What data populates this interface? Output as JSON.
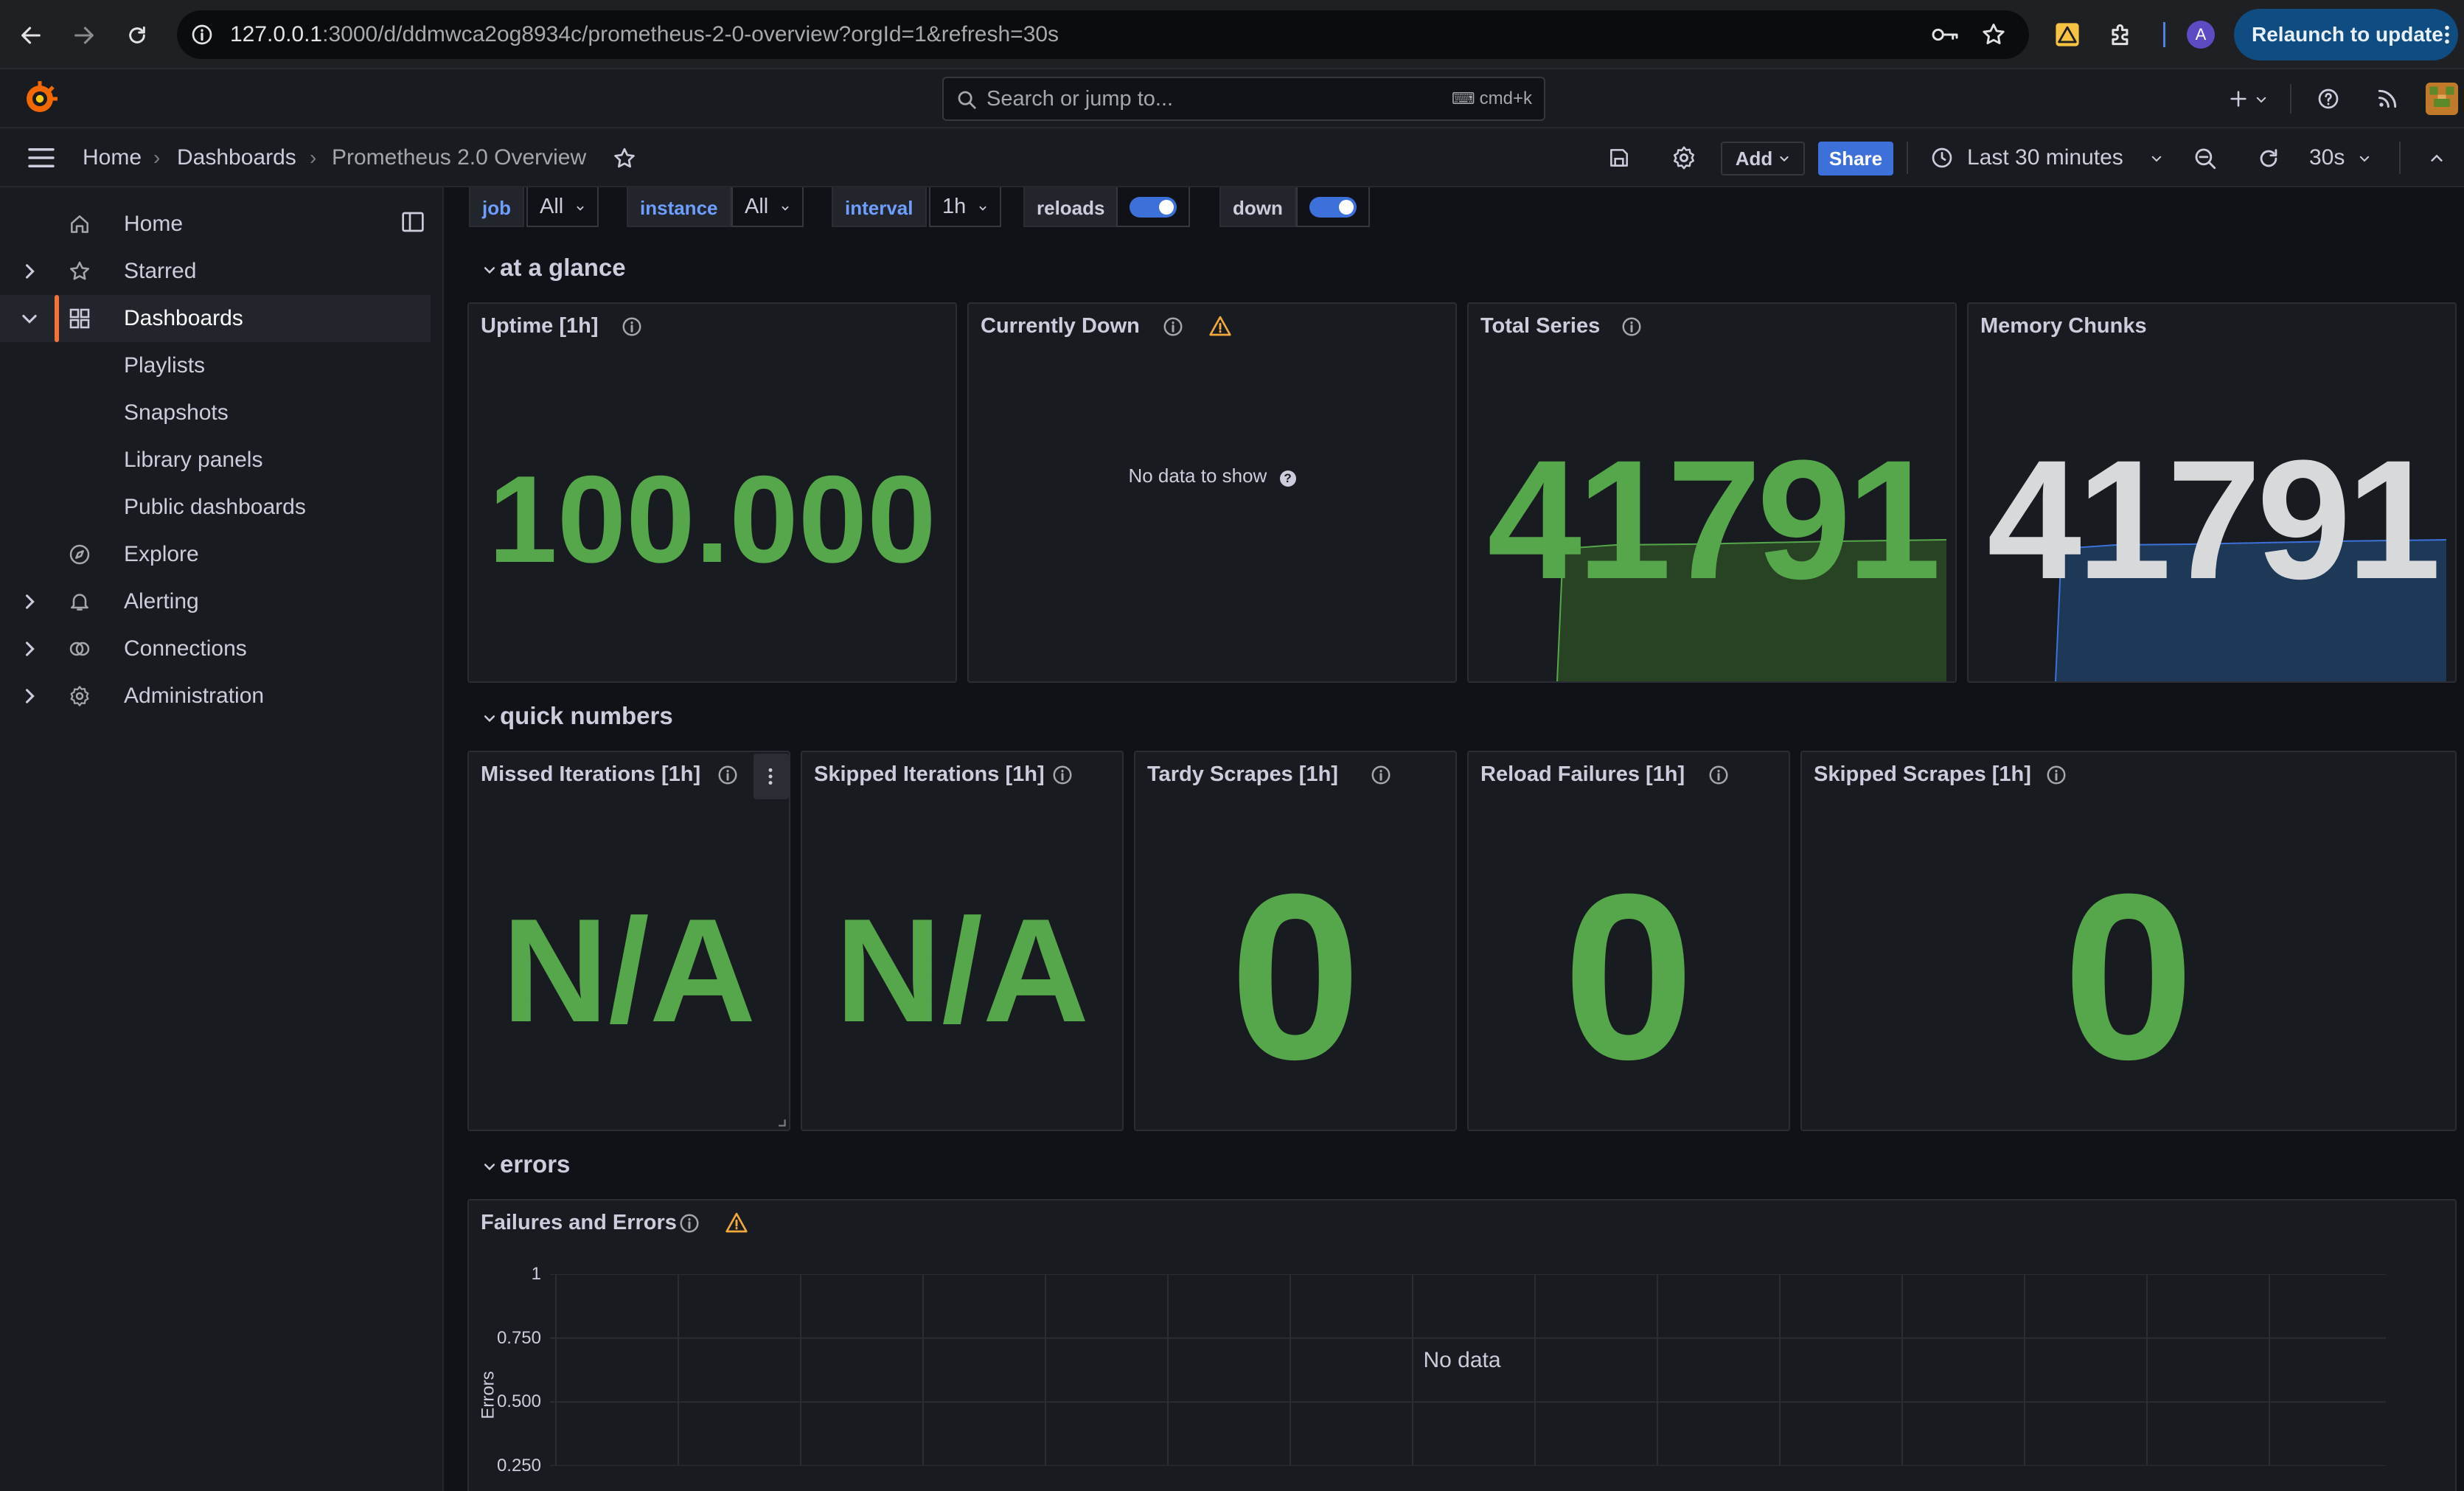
{
  "browser": {
    "url_host": "127.0.0.1",
    "url_rest": ":3000/d/ddmwca2og8934c/prometheus-2-0-overview?orgId=1&refresh=30s",
    "profile_initial": "A",
    "relaunch_label": "Relaunch to update"
  },
  "topbar": {
    "search_placeholder": "Search or jump to...",
    "search_shortcut": "cmd+k"
  },
  "breadcrumb": {
    "home": "Home",
    "dashboards": "Dashboards",
    "current": "Prometheus 2.0 Overview"
  },
  "toolbar": {
    "add_label": "Add",
    "share_label": "Share",
    "time_range": "Last 30 minutes",
    "refresh_interval": "30s"
  },
  "sidebar": {
    "items": [
      {
        "label": "Home",
        "icon": "home-icon"
      },
      {
        "label": "Starred",
        "icon": "star-icon"
      },
      {
        "label": "Dashboards",
        "icon": "grid-icon"
      },
      {
        "label": "Playlists"
      },
      {
        "label": "Snapshots"
      },
      {
        "label": "Library panels"
      },
      {
        "label": "Public dashboards"
      },
      {
        "label": "Explore",
        "icon": "compass-icon"
      },
      {
        "label": "Alerting",
        "icon": "bell-icon"
      },
      {
        "label": "Connections",
        "icon": "connections-icon"
      },
      {
        "label": "Administration",
        "icon": "gear-icon"
      }
    ]
  },
  "variables": {
    "job_label": "job",
    "job_value": "All",
    "instance_label": "instance",
    "instance_value": "All",
    "interval_label": "interval",
    "interval_value": "1h",
    "reloads_label": "reloads",
    "down_label": "down"
  },
  "rows": {
    "at_a_glance": "at a glance",
    "quick_numbers": "quick numbers",
    "errors": "errors"
  },
  "panels": {
    "uptime": {
      "title": "Uptime [1h]",
      "value": "100.000"
    },
    "currently_down": {
      "title": "Currently Down",
      "message": "No data to show"
    },
    "total_series": {
      "title": "Total Series",
      "value": "41791"
    },
    "memory_chunks": {
      "title": "Memory Chunks",
      "value": "41791"
    },
    "missed_iterations": {
      "title": "Missed Iterations [1h]",
      "value": "N/A"
    },
    "skipped_iterations": {
      "title": "Skipped Iterations [1h]",
      "value": "N/A"
    },
    "tardy_scrapes": {
      "title": "Tardy Scrapes [1h]",
      "value": "0"
    },
    "reload_failures": {
      "title": "Reload Failures [1h]",
      "value": "0"
    },
    "skipped_scrapes": {
      "title": "Skipped Scrapes [1h]",
      "value": "0"
    },
    "failures_errors": {
      "title": "Failures and Errors",
      "message": "No data",
      "y_axis_label": "Errors"
    }
  },
  "colors": {
    "accent": "#f5733a",
    "primary": "#3d71d9",
    "stat_green": "#56a64b",
    "warning": "#f2a93b",
    "relaunch_bg": "#0f4c81"
  },
  "chart_data": {
    "type": "line",
    "title": "Failures and Errors",
    "xlabel": "",
    "ylabel": "Errors",
    "ylim": [
      0,
      1
    ],
    "y_ticks": [
      "1",
      "0.750",
      "0.500",
      "0.250"
    ],
    "grid": true,
    "series": [],
    "annotation": "No data"
  }
}
